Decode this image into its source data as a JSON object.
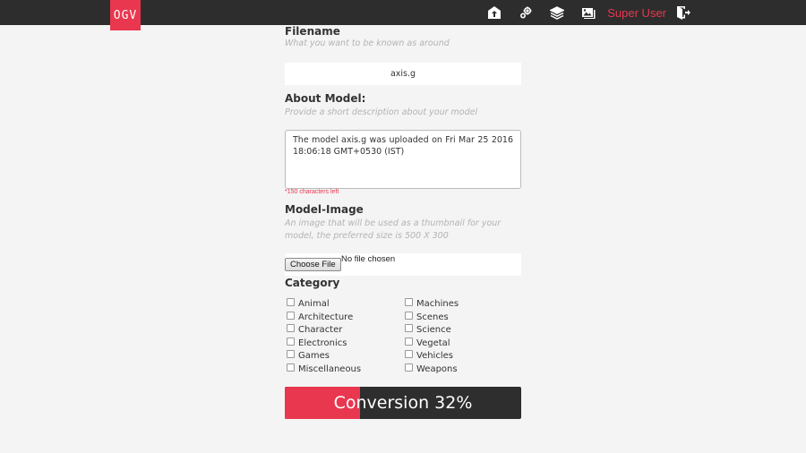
{
  "header": {
    "logo_text": "OGV",
    "nav_icons": [
      "upload-icon",
      "settings-icon",
      "layers-icon",
      "gallery-icon"
    ],
    "user_label": "Super User",
    "logout_icon": "logout-icon",
    "brand_color": "#e9374f",
    "bar_color": "#2d2d2d"
  },
  "form": {
    "filename": {
      "label": "Filename",
      "hint": "What you want to be known as around",
      "value": "axis.g"
    },
    "about": {
      "label": "About Model:",
      "hint": "Provide a short description about your model",
      "value": "The model axis.g was uploaded on Fri Mar 25 2016 18:06:18 GMT+0530 (IST)",
      "chars_left": "*150 characters left"
    },
    "image": {
      "label": "Model-Image",
      "hint": "An image that will be used as a thumbnail for your model, the preferred size is 500 X 300",
      "button": "Choose File",
      "status": "No file chosen"
    },
    "category": {
      "label": "Category",
      "left": [
        "Animal",
        "Architecture",
        "Character",
        "Electronics",
        "Games",
        "Miscellaneous"
      ],
      "right": [
        "Machines",
        "Scenes",
        "Science",
        "Vegetal",
        "Vehicles",
        "Weapons"
      ]
    },
    "conversion": {
      "text": "Conversion 32%",
      "progress": 0.32
    }
  }
}
